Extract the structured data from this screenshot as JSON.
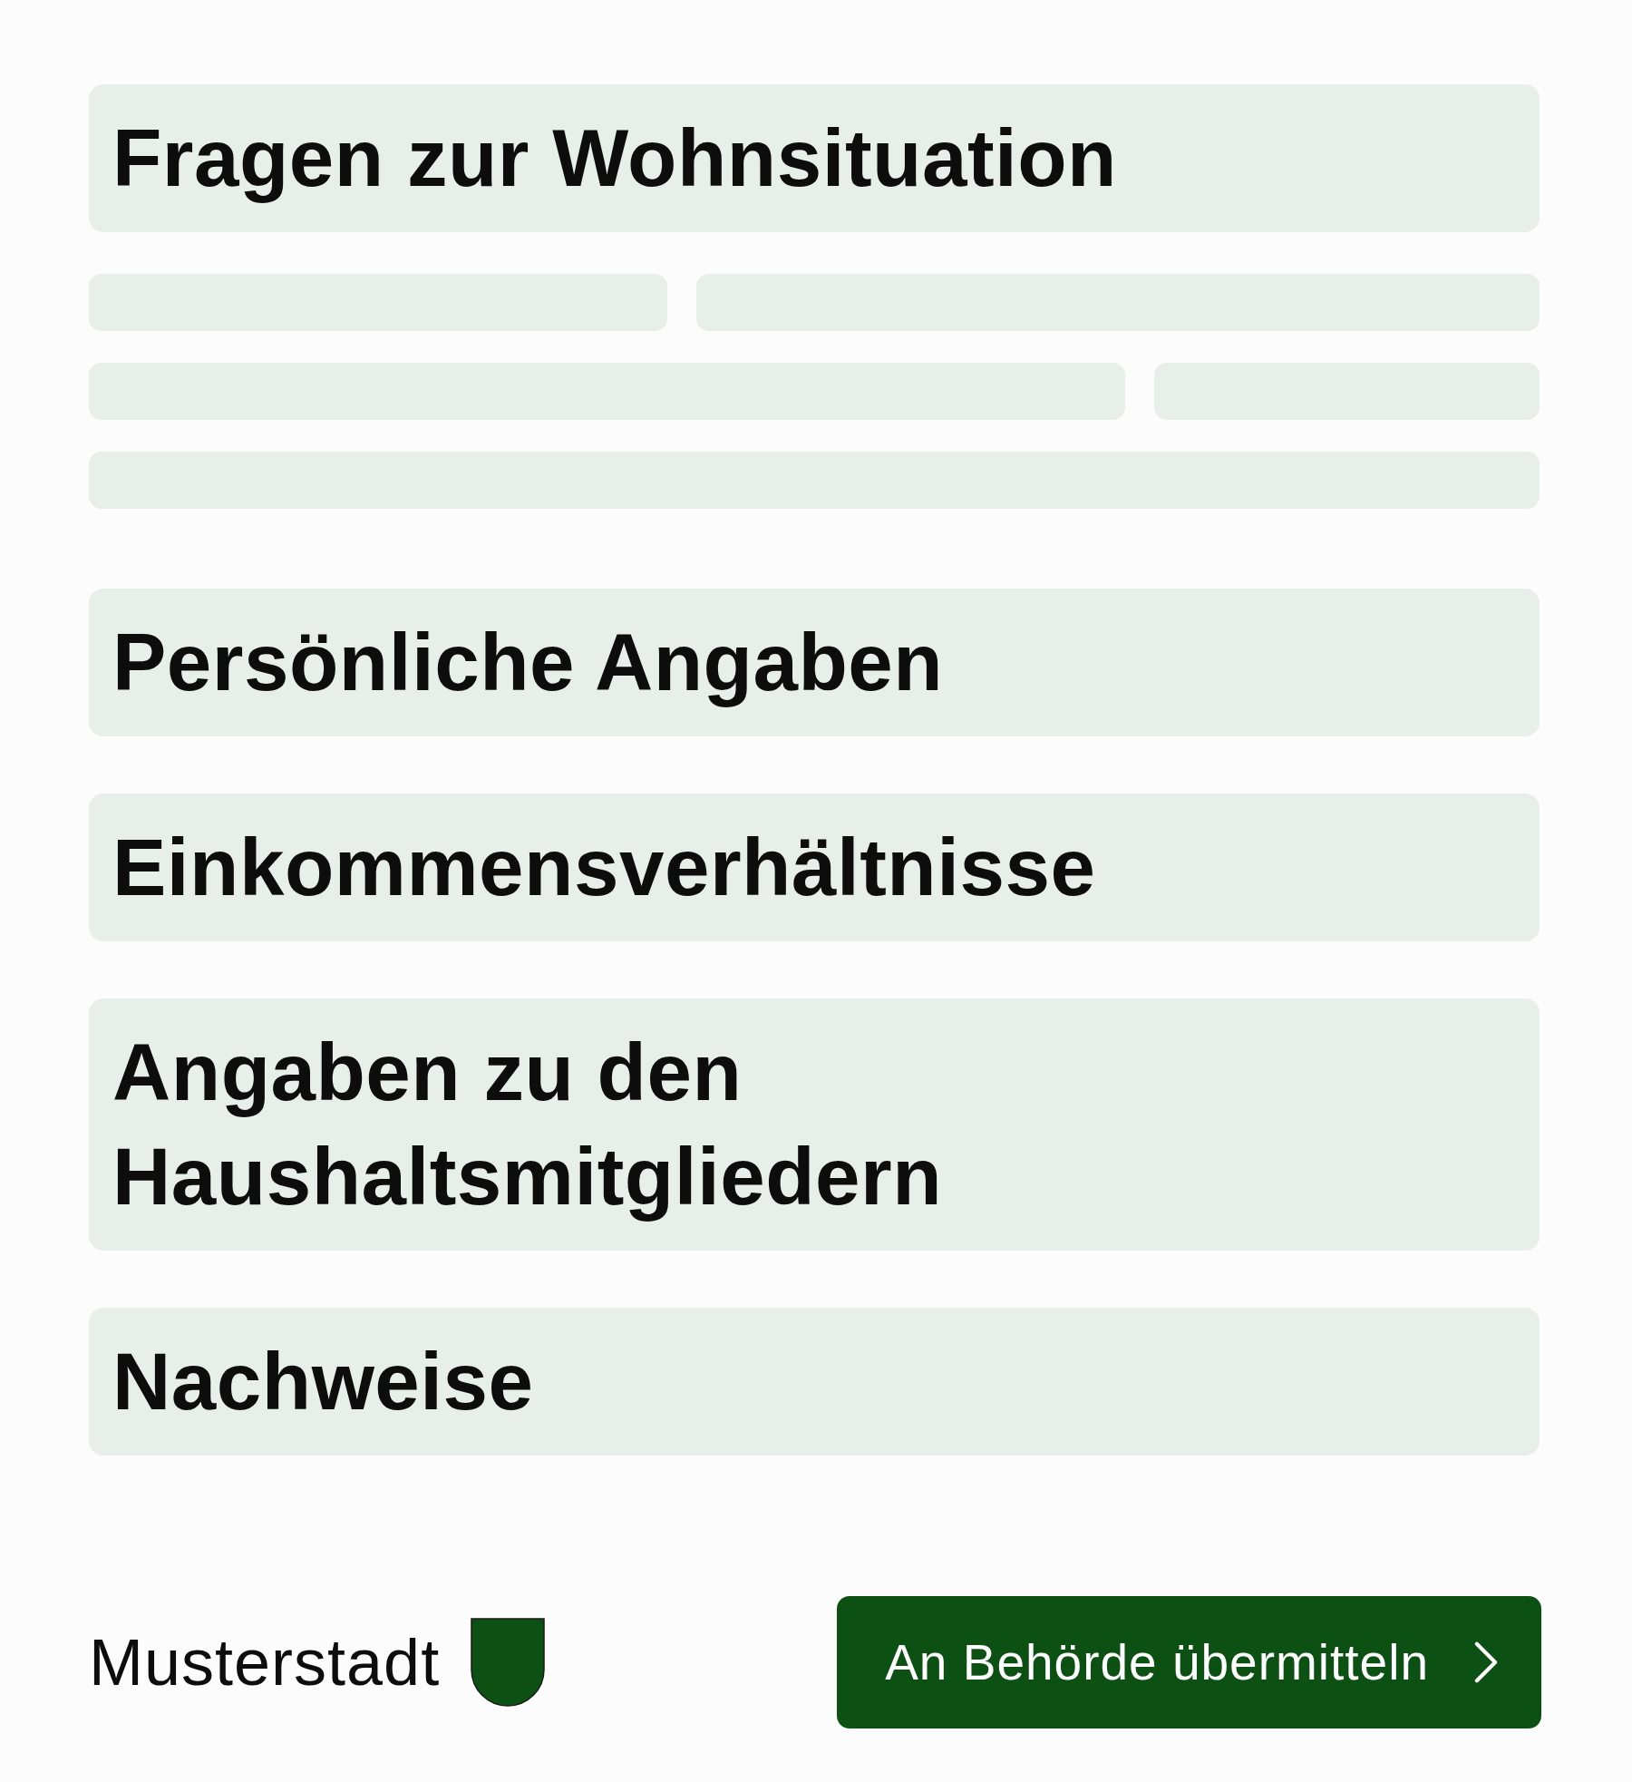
{
  "title": "Fragen zur Wohnsituation",
  "sections": [
    {
      "title": "Persönliche Angaben"
    },
    {
      "title": "Einkommensverhältnisse"
    },
    {
      "title": "Angaben zu den Haushaltsmitgliedern"
    },
    {
      "title": "Nachweise"
    }
  ],
  "footer": {
    "city": "Musterstadt",
    "submit_button": "An Behörde übermitteln"
  }
}
